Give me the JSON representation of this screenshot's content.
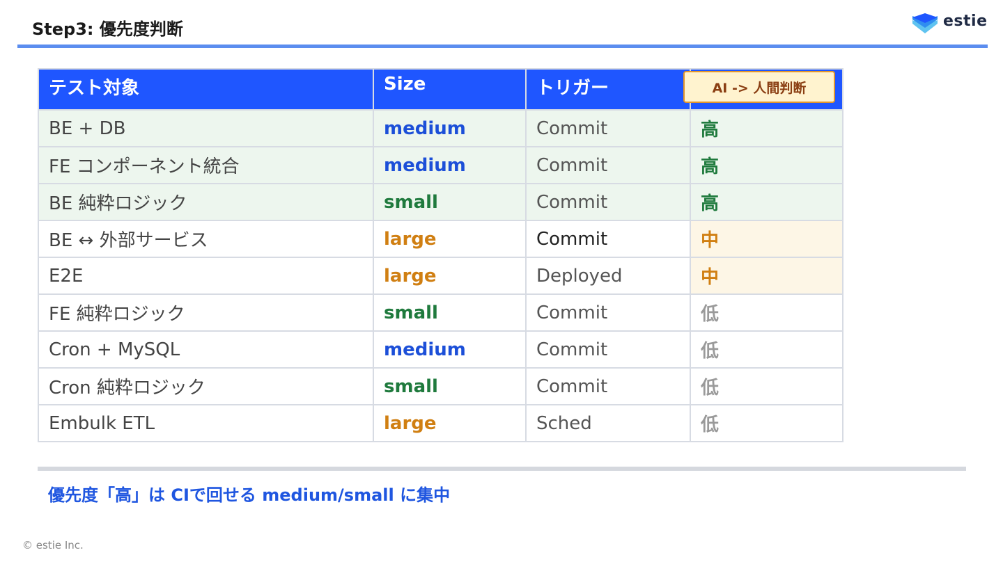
{
  "header": {
    "title": "Step3: 優先度判断",
    "logo_text": "estie"
  },
  "table": {
    "columns": [
      "テスト対象",
      "Size",
      "トリガー",
      ""
    ],
    "ai_badge": "AI -> 人間判断",
    "rows": [
      {
        "target": "BE + DB",
        "size": "medium",
        "trigger": "Commit",
        "priority": "高"
      },
      {
        "target": "FE コンポーネント統合",
        "size": "medium",
        "trigger": "Commit",
        "priority": "高"
      },
      {
        "target": "BE 純粋ロジック",
        "size": "small",
        "trigger": "Commit",
        "priority": "高"
      },
      {
        "target": "BE ↔ 外部サービス",
        "size": "large",
        "trigger": "Commit",
        "priority": "中"
      },
      {
        "target": "E2E",
        "size": "large",
        "trigger": "Deployed",
        "priority": "中"
      },
      {
        "target": "FE 純粋ロジック",
        "size": "small",
        "trigger": "Commit",
        "priority": "低"
      },
      {
        "target": "Cron + MySQL",
        "size": "medium",
        "trigger": "Commit",
        "priority": "低"
      },
      {
        "target": "Cron 純粋ロジック",
        "size": "small",
        "trigger": "Commit",
        "priority": "低"
      },
      {
        "target": "Embulk ETL",
        "size": "large",
        "trigger": "Sched",
        "priority": "低"
      }
    ]
  },
  "summary": "優先度「高」は CIで回せる medium/small に集中",
  "footer": "© estie Inc.",
  "colors": {
    "header_bg": "#1f56ff",
    "medium": "#1c4fd8",
    "small": "#1f7a3d",
    "large": "#d07f12",
    "high_row_bg": "#edf6ee",
    "mid_cell_bg": "#fdf6e6"
  }
}
